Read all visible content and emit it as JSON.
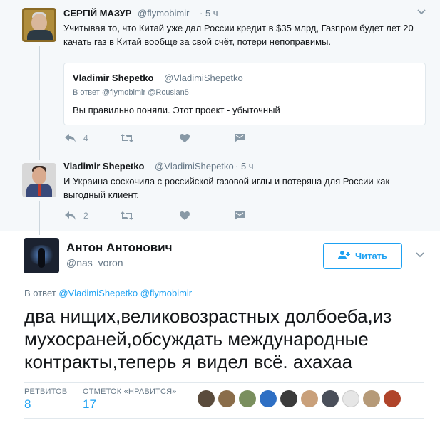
{
  "tweet1": {
    "name": "СЕРГІЙ МАЗУР",
    "handle": "@flymobimir",
    "time": "· 5 ч",
    "text": "Учитывая то, что Китай уже дал России кредит в $35 млрд, Газпром будет лет 20 качать газ в Китай вообще за свой счёт, потери непоправимы.",
    "quoted": {
      "name": "Vladimir Shepetko",
      "handle": "@VladimiShepetko",
      "reply_to": "В ответ @flymobimir @Rouslan5",
      "text": "Вы правильно поняли. Этот проект -  убыточный"
    },
    "reply_count": "4",
    "icons": [
      "reply-icon",
      "retweet-icon",
      "heart-icon",
      "direct-message-icon",
      "chevron-down-icon"
    ]
  },
  "tweet2": {
    "name": "Vladimir Shepetko",
    "handle": "@VladimiShepetko",
    "time": "· 5 ч",
    "text": "И Украина соскочила с российской газовой иглы и потеряна для России как выгодный клиент.",
    "reply_count": "2"
  },
  "main_tweet": {
    "name": "Антон Антонович",
    "handle": "@nas_voron",
    "follow_label": "Читать",
    "reply_to_prefix": "В ответ",
    "reply_to_users": [
      "@VladimiShepetko",
      "@flymobimir"
    ],
    "text": "два нищих,великовозрастных долбоеба,из мухосраней,обсуждать международные контракты,теперь я видел всё. ахахаа",
    "stats": {
      "retweets_label": "РЕТВИТОВ",
      "retweets_value": "8",
      "likes_label": "ОТМЕТОК «НРАВИТСЯ»",
      "likes_value": "17"
    },
    "likers_count": 9
  },
  "colors": {
    "accent": "#1da1f2",
    "muted": "#657786",
    "icon": "#8899a6",
    "thread_bg": "#f5f8fa"
  }
}
